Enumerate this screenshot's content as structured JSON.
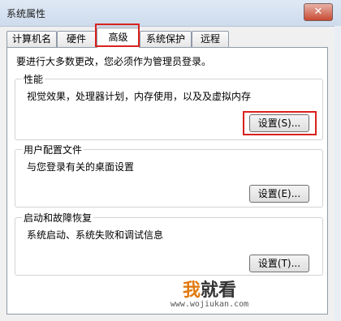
{
  "window": {
    "title": "系统属性",
    "close_label": "✕"
  },
  "tabs": [
    {
      "label": "计算机名",
      "active": false
    },
    {
      "label": "硬件",
      "active": false
    },
    {
      "label": "高级",
      "active": true
    },
    {
      "label": "系统保护",
      "active": false
    },
    {
      "label": "远程",
      "active": false
    }
  ],
  "notice": "要进行大多数更改，您必须作为管理员登录。",
  "groups": {
    "performance": {
      "title": "性能",
      "description": "视觉效果，处理器计划，内存使用，以及及虚拟内存",
      "button": "设置(S)..."
    },
    "user_profiles": {
      "title": "用户配置文件",
      "description": "与您登录有关的桌面设置",
      "button": "设置(E)..."
    },
    "startup_recovery": {
      "title": "启动和故障恢复",
      "description": "系统启动、系统失败和调试信息",
      "button": "设置(T)..."
    }
  },
  "watermark": {
    "logo_a": "我",
    "logo_b": "就看",
    "url": "www.wojiukan.com"
  },
  "colors": {
    "highlight": "#d9211c",
    "title_bar": "#dfe9f5"
  }
}
